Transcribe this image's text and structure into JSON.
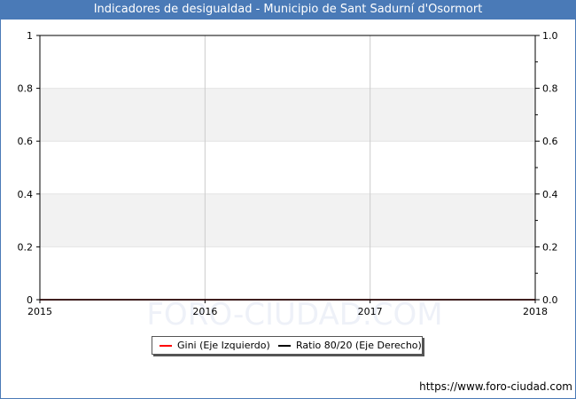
{
  "title": "Indicadores de desigualdad - Municipio de Sant Sadurní d'Osormort",
  "footer": {
    "url": "https://www.foro-ciudad.com"
  },
  "watermark": "FORO-CIUDAD.COM",
  "colors": {
    "header": "#4a7ab7",
    "gini": "#ff0000",
    "ratio": "#000000",
    "band": "#f2f2f2",
    "grid": "#cccccc"
  },
  "legend": {
    "gini_label": "Gini (Eje Izquierdo)",
    "ratio_label": "Ratio 80/20 (Eje Derecho)"
  },
  "chart_data": {
    "type": "line",
    "x": [
      2015,
      2016,
      2017,
      2018
    ],
    "xlim": [
      2015,
      2018
    ],
    "x_tick_labels": [
      "2015",
      "2016",
      "2017",
      "2018"
    ],
    "ylim_left": [
      0,
      1
    ],
    "ylim_right": [
      0,
      1
    ],
    "y_left_tick_labels": [
      "0",
      "0.2",
      "0.4",
      "0.6",
      "0.8",
      "1"
    ],
    "y_right_tick_labels": [
      "0.0",
      "0.2",
      "0.4",
      "0.6",
      "0.8",
      "1.0"
    ],
    "y_ticks": [
      0,
      0.2,
      0.4,
      0.6,
      0.8,
      1.0
    ],
    "series": [
      {
        "name": "Gini (Eje Izquierdo)",
        "axis": "left",
        "color": "#ff0000",
        "values": [
          0,
          0,
          0,
          0
        ]
      },
      {
        "name": "Ratio 80/20 (Eje Derecho)",
        "axis": "right",
        "color": "#000000",
        "values": [
          0,
          0,
          0,
          0
        ]
      }
    ],
    "grid": true,
    "legend_position": "bottom-center"
  }
}
